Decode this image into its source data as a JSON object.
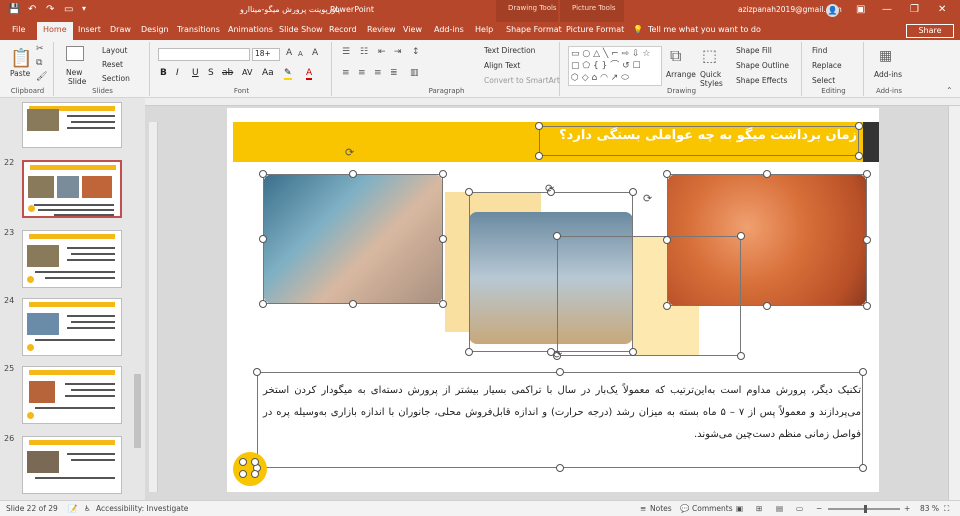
{
  "titlebar": {
    "doc_title": "پاورپوینت پرورش میگو-میناارو",
    "app_name": "PowerPoint",
    "context_tools_1": "Drawing Tools",
    "context_tools_2": "Picture Tools",
    "account": "azizpanah2019@gmail.com"
  },
  "tabs": {
    "file": "File",
    "home": "Home",
    "insert": "Insert",
    "draw": "Draw",
    "design": "Design",
    "transitions": "Transitions",
    "animations": "Animations",
    "slideshow": "Slide Show",
    "record": "Record",
    "review": "Review",
    "view": "View",
    "addins": "Add-ins",
    "help": "Help",
    "shape_format": "Shape Format",
    "picture_format": "Picture Format",
    "tellme": "Tell me what you want to do",
    "share": "Share"
  },
  "ribbon": {
    "clipboard": {
      "paste": "Paste",
      "label": "Clipboard"
    },
    "slides": {
      "new_slide": "New",
      "new_slide2": "Slide",
      "layout": "Layout",
      "reset": "Reset",
      "section": "Section",
      "label": "Slides"
    },
    "font": {
      "font_size": "18+",
      "label": "Font"
    },
    "paragraph": {
      "text_direction": "Text Direction",
      "align_text": "Align Text",
      "smartart": "Convert to SmartArt",
      "label": "Paragraph"
    },
    "drawing": {
      "arrange": "Arrange",
      "quick_styles": "Quick",
      "quick_styles2": "Styles",
      "shape_fill": "Shape Fill",
      "shape_outline": "Shape Outline",
      "shape_effects": "Shape Effects",
      "label": "Drawing"
    },
    "editing": {
      "find": "Find",
      "replace": "Replace",
      "select": "Select",
      "label": "Editing"
    },
    "addins": {
      "addins": "Add-ins",
      "label": "Add-ins"
    }
  },
  "thumbnails": [
    {
      "num": "",
      "selected": false
    },
    {
      "num": "22",
      "selected": true
    },
    {
      "num": "23",
      "selected": false
    },
    {
      "num": "24",
      "selected": false
    },
    {
      "num": "25",
      "selected": false
    },
    {
      "num": "26",
      "selected": false
    }
  ],
  "slide": {
    "title": "زمان برداشت میگو به چه عواملی بستگی دارد؟",
    "body": "تکنیک دیگر، پرورش مداوم است به‌این‌ترتیب که معمولاً یک‌بار در سال با تراکمی بسیار بیشتر از پرورش دسته‌ای به میگودار کردن استخر می‌پردازند و معمولاً پس از ۷ – ۵ ماه بسته به میزان رشد (درجه حرارت) و اندازه قابل‌فروش محلی، جانوران با اندازه بازاری به‌وسیله پره در فواصل زمانی منظم دست‌چین می‌شوند.",
    "accent_color": "#f4b818",
    "title_band_color": "#f9c400"
  },
  "status": {
    "slide_info": "Slide 22 of 29",
    "accessibility": "Accessibility: Investigate",
    "notes": "Notes",
    "comments": "Comments",
    "zoom": "83 %"
  },
  "colors": {
    "brand": "#b7472a"
  }
}
